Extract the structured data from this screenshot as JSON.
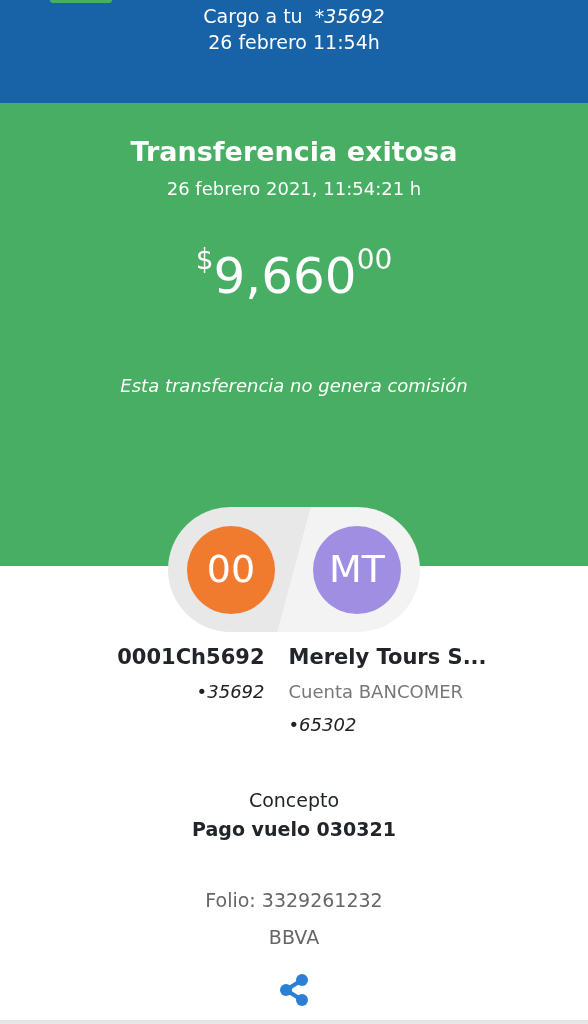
{
  "header": {
    "charge_label": "Cargo a tu",
    "charge_account": "*35692",
    "date": "26 febrero 11:54h"
  },
  "result": {
    "title": "Transferencia exitosa",
    "datetime": "26 febrero 2021, 11:54:21 h",
    "currency": "$",
    "amount": "9,660",
    "cents": "00",
    "note": "Esta transferencia no genera comisión"
  },
  "parties": [
    {
      "initials": "00",
      "color": "#f07a2e",
      "name": "0001Ch5692",
      "account": "•35692"
    },
    {
      "initials": "MT",
      "color": "#a08ee2",
      "name": "Merely Tours S...",
      "bank": "Cuenta BANCOMER",
      "account": "•65302"
    }
  ],
  "concept": {
    "label": "Concepto",
    "value": "Pago vuelo 030321"
  },
  "folio": "Folio: 3329261232",
  "bank": "BBVA"
}
